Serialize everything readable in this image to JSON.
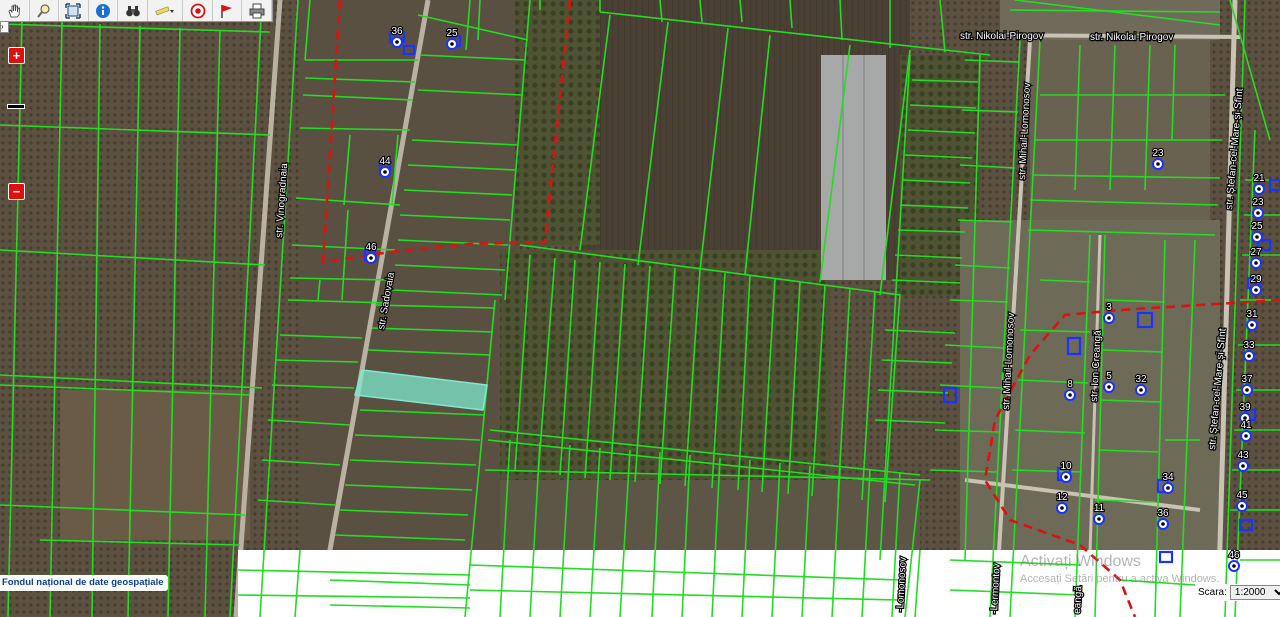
{
  "toolbar": {
    "tools": [
      {
        "name": "pan-hand-icon"
      },
      {
        "name": "zoom-magnifier-icon"
      },
      {
        "name": "full-extent-icon"
      },
      {
        "name": "info-icon"
      },
      {
        "name": "binoculars-icon"
      },
      {
        "name": "measure-ruler-icon"
      },
      {
        "name": "target-icon"
      },
      {
        "name": "flag-icon"
      },
      {
        "name": "print-icon"
      }
    ]
  },
  "zoom": {
    "plus": "+",
    "minus": "−"
  },
  "streets": {
    "pirogov_1": "str. Nikolai-Pirogov",
    "pirogov_2": "str. Nikolai-Pirogov",
    "vinogradnaia": "str. Vinogradnaia",
    "sadovaia": "str. Sadovaia",
    "lomonosov": "str. Mihail-Lomonosov",
    "lomonosov_2": "str. Mihail-Lomonosov",
    "creanga": "str. Ion-Creangă",
    "stefan_1": "str. Ștefan-cel-Mare-și-Sfînt",
    "stefan_2": "str. Ștefan-cel-Mare-și-Sfînt",
    "lomonosov_bottom": "-Lomonosov",
    "lermontov_bottom": "-Lermontov",
    "creanga_bottom": "eangă"
  },
  "house_numbers": {
    "h36a": "36",
    "h25": "25",
    "h44": "44",
    "h46": "46",
    "h23": "23",
    "h3": "3",
    "h8": "8",
    "h5": "5",
    "h32": "32",
    "h10": "10",
    "h12": "12",
    "h11": "11",
    "h34": "34",
    "h36b": "36",
    "h21": "21",
    "h23r": "23",
    "h25r": "25",
    "h27": "27",
    "h29": "29",
    "h31": "31",
    "h33": "33",
    "h37": "37",
    "h39": "39",
    "h41": "41",
    "h43": "43",
    "h45": "45",
    "h46b": "46"
  },
  "attribution": "Fondul național de date geospațiale",
  "watermark": {
    "title": "Activați Windows",
    "subtitle": "Accesați Setări pentru a activa Windows."
  },
  "scale": {
    "label": "Scara:",
    "value": "1:2000"
  },
  "colors": {
    "parcel_line": "#22dd22",
    "boundary": "#dd1111",
    "selected_parcel": "#7fe8cf",
    "building": "#1a33ff"
  }
}
